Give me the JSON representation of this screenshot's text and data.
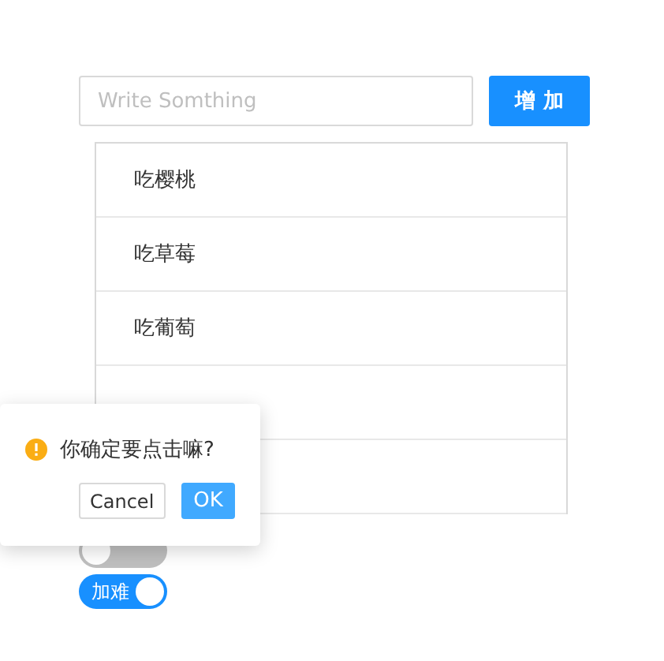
{
  "input": {
    "placeholder": "Write Somthing"
  },
  "add_button": "增 加",
  "items": [
    "吃樱桃",
    "吃草莓",
    "吃葡萄"
  ],
  "popconfirm": {
    "title": "你确定要点击嘛?",
    "cancel": "Cancel",
    "ok": "OK"
  },
  "switches": [
    {
      "on": false
    },
    {
      "label": "加难",
      "on": true
    }
  ]
}
